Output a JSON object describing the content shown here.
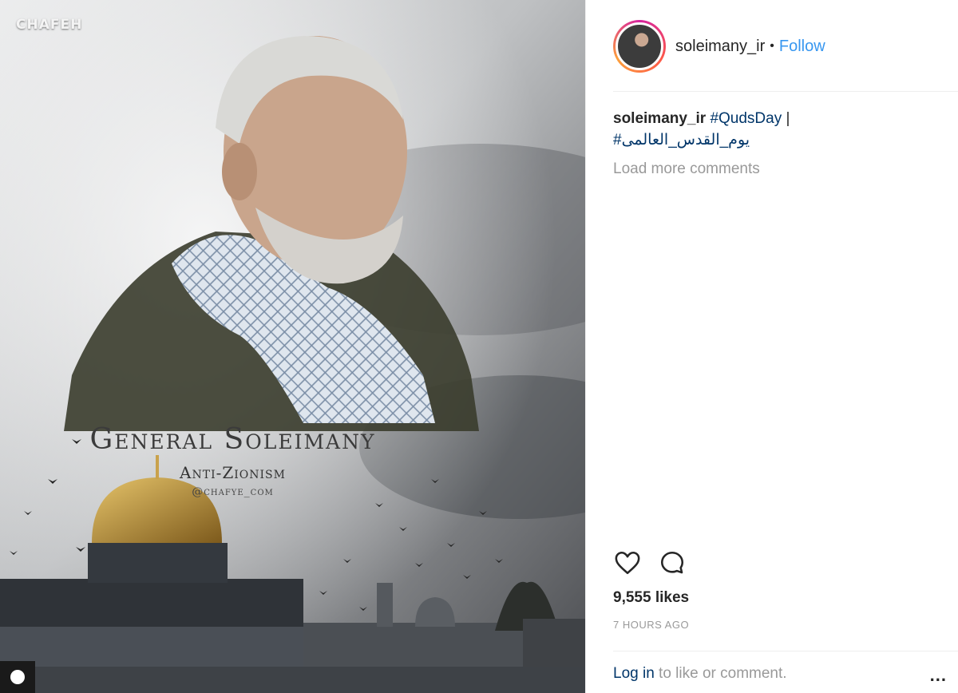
{
  "post": {
    "image": {
      "watermark_top": "CHAFEH",
      "watermark_bottom": "",
      "title": "General Soleimany",
      "subtitle": "Anti-Zionism",
      "handle": "@chafye_com"
    },
    "header": {
      "username": "soleimany_ir",
      "separator": "•",
      "follow_label": "Follow"
    },
    "caption": {
      "username": "soleimany_ir",
      "hashtag_en": "#QudsDay",
      "pipe": "|",
      "hashtag_ar": "یوم_القدس_العالمی#"
    },
    "load_more": "Load more comments",
    "actions": {
      "like_icon": "heart-icon",
      "comment_icon": "comment-icon"
    },
    "likes": "9,555 likes",
    "time": "7 HOURS AGO",
    "footer": {
      "login_link": "Log in",
      "login_rest": " to like or comment.",
      "more_label": "..."
    },
    "colors": {
      "link_blue": "#3897f0",
      "caption_link": "#003569",
      "muted": "#999999"
    }
  }
}
